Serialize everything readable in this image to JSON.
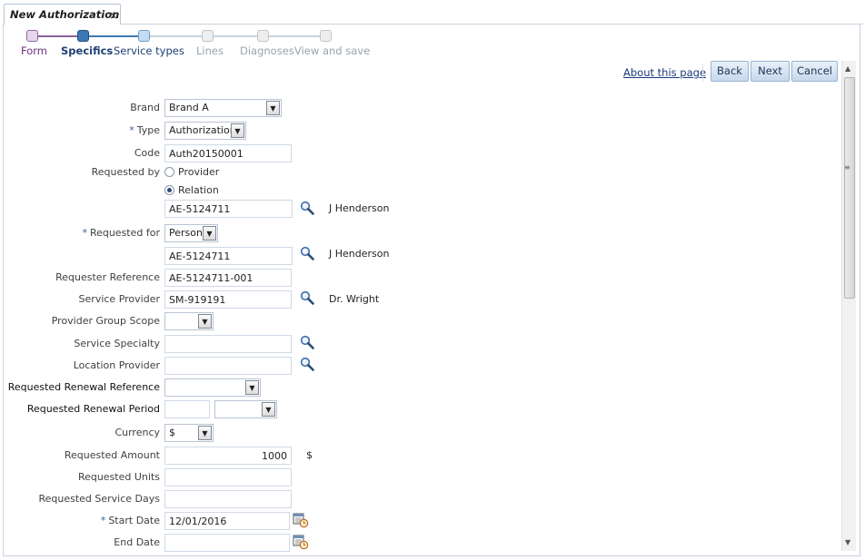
{
  "tab": {
    "title": "New Authorization",
    "close": "×"
  },
  "train": {
    "steps": [
      {
        "label": "Form"
      },
      {
        "label": "Specifics"
      },
      {
        "label": "Service types"
      },
      {
        "label": "Lines"
      },
      {
        "label": "Diagnoses"
      },
      {
        "label": "View and save"
      }
    ]
  },
  "toolbar": {
    "about": "About this page",
    "back": "Back",
    "next": "Next",
    "cancel": "Cancel"
  },
  "form": {
    "brand": {
      "label": "Brand",
      "value": "Brand A"
    },
    "type": {
      "label": "Type",
      "value": "Authorization",
      "required": "*"
    },
    "code": {
      "label": "Code",
      "value": "Auth20150001"
    },
    "requested_by": {
      "label": "Requested by",
      "options": [
        "Provider",
        "Relation"
      ],
      "selected": "Relation",
      "value": "AE-5124711",
      "name": "J Henderson"
    },
    "requested_for": {
      "label": "Requested for",
      "value": "Person",
      "required": "*",
      "ref": "AE-5124711",
      "name": "J Henderson"
    },
    "requester_reference": {
      "label": "Requester Reference",
      "value": "AE-5124711-001"
    },
    "service_provider": {
      "label": "Service Provider",
      "value": "SM-919191",
      "name": "Dr. Wright"
    },
    "provider_group_scope": {
      "label": "Provider Group Scope",
      "value": ""
    },
    "service_specialty": {
      "label": "Service Specialty",
      "value": ""
    },
    "location_provider": {
      "label": "Location Provider",
      "value": ""
    },
    "requested_renewal_reference": {
      "label": "Requested Renewal Reference",
      "value": ""
    },
    "requested_renewal_period": {
      "label": "Requested Renewal Period",
      "value": "",
      "unit": ""
    },
    "currency": {
      "label": "Currency",
      "value": "$"
    },
    "requested_amount": {
      "label": "Requested Amount",
      "value": "1000",
      "unit": "$"
    },
    "requested_units": {
      "label": "Requested Units",
      "value": ""
    },
    "requested_service_days": {
      "label": "Requested Service Days",
      "value": ""
    },
    "start_date": {
      "label": "Start Date",
      "value": "12/01/2016",
      "required": "*"
    },
    "end_date": {
      "label": "End Date",
      "value": ""
    }
  },
  "colors": {
    "accent": "#1f3f75",
    "visited": "#6b2d7a",
    "disabled": "#9aa3ad",
    "button_bg": "#c7d8ec"
  },
  "icons": {
    "search": "magnifier-icon",
    "calendar": "calendar-icon"
  }
}
